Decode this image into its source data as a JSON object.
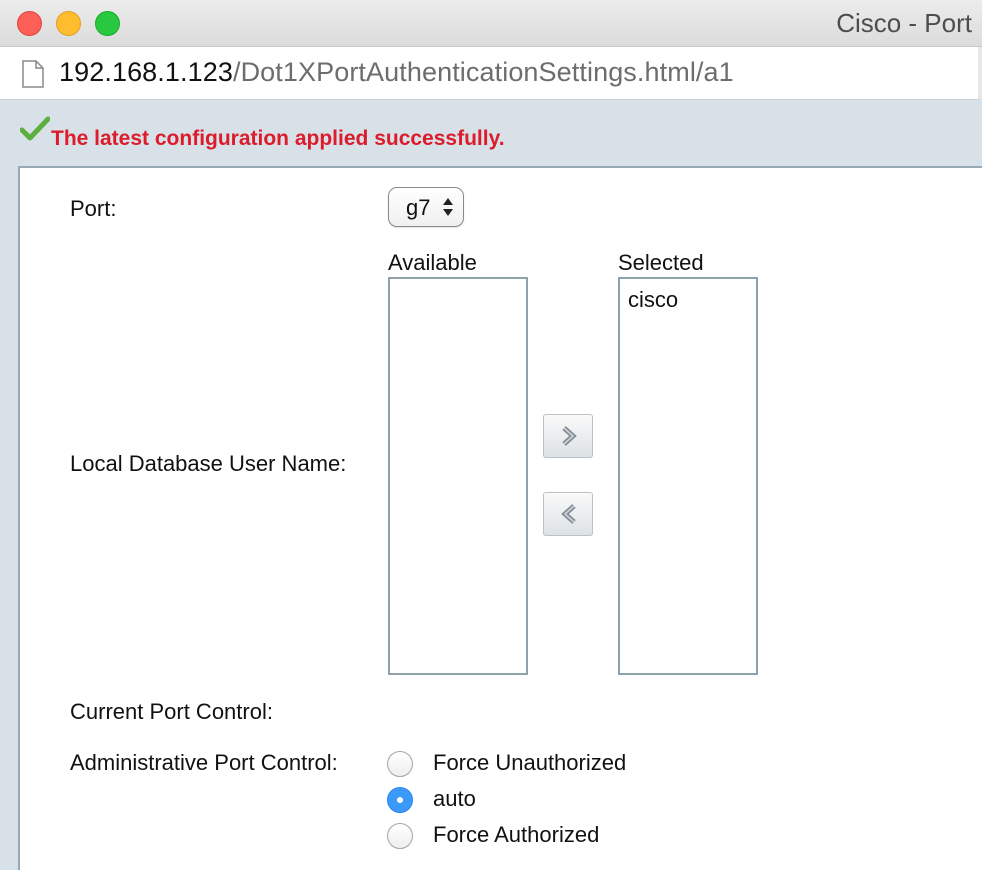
{
  "window": {
    "title": "Cisco - Port"
  },
  "urlbar": {
    "host": "192.168.1.123",
    "path": "/Dot1XPortAuthenticationSettings.html/a1"
  },
  "status": {
    "message": "The latest configuration applied successfully.",
    "color": "#dc1b2b"
  },
  "form": {
    "port_label": "Port:",
    "port_value": "g7",
    "user_name_label": "Local Database User Name:",
    "available_header": "Available",
    "available_items": [],
    "selected_header": "Selected",
    "selected_items": [
      "cisco"
    ],
    "current_port_control_label": "Current Port Control:",
    "admin_port_control_label": "Administrative Port Control:",
    "admin_options": [
      {
        "label": "Force Unauthorized",
        "checked": false
      },
      {
        "label": "auto",
        "checked": true
      },
      {
        "label": "Force Authorized",
        "checked": false
      }
    ]
  },
  "icons": {
    "page": "page-icon",
    "check": "check-icon",
    "move_right": "chevron-right-icon",
    "move_left": "chevron-left-icon"
  },
  "colors": {
    "accent": "#3b99fc",
    "frame": "#d8e0e8"
  }
}
